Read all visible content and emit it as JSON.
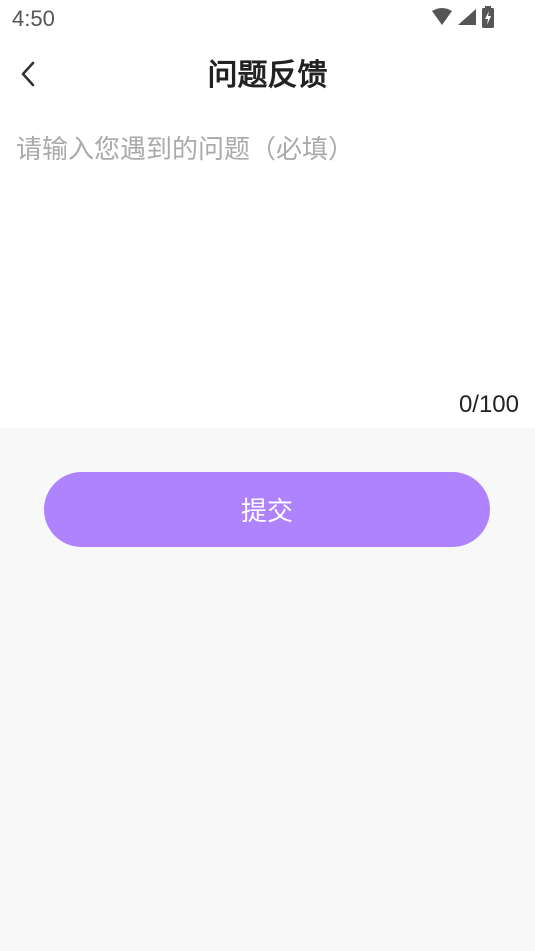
{
  "status_bar": {
    "time": "4:50",
    "icons": [
      "wifi-icon",
      "cellular-signal-icon",
      "battery-charging-icon"
    ]
  },
  "header": {
    "title": "问题反馈",
    "back_icon": "chevron-left-icon"
  },
  "feedback": {
    "placeholder": "请输入您遇到的问题（必填）",
    "value": "",
    "counter": "0/100"
  },
  "submit": {
    "label": "提交"
  },
  "colors": {
    "accent": "#B083FE",
    "page_background": "#F8F8F9",
    "card_background": "#FFFFFF",
    "title_text": "#222222",
    "placeholder_text": "#AAAAAA"
  }
}
